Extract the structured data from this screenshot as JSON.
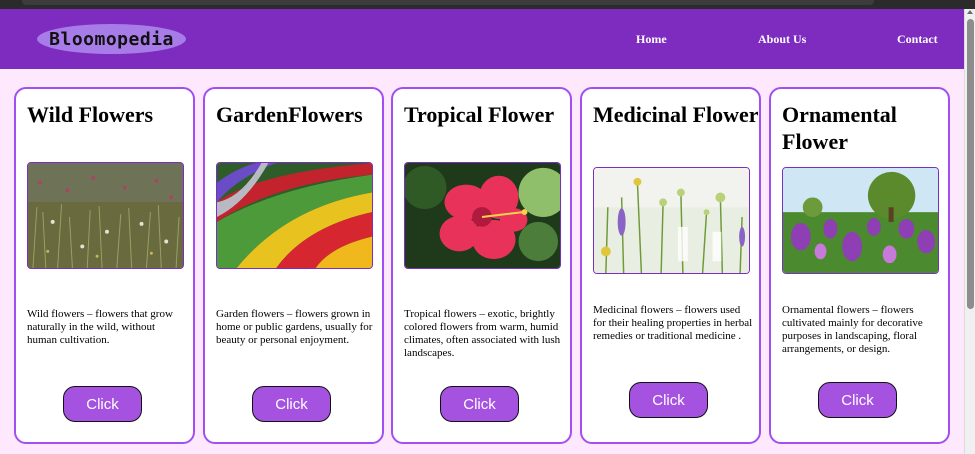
{
  "site": {
    "logo": "Bloomopedia",
    "nav": [
      "Home",
      "About Us",
      "Contact"
    ]
  },
  "cards": [
    {
      "title": "Wild Flowers",
      "image": "wildflower-meadow-image",
      "description": "Wild flowers – flowers that grow naturally in the wild, without human cultivation.",
      "button": "Click"
    },
    {
      "title": "GardenFlowers",
      "image": "tulip-garden-rows-image",
      "description": "Garden flowers – flowers grown in home or public gardens, usually for beauty or personal enjoyment.",
      "button": "Click"
    },
    {
      "title": "Tropical Flower",
      "image": "hibiscus-image",
      "description": "Tropical flowers – exotic, brightly colored flowers from warm, humid climates, often associated with lush landscapes.",
      "button": "Click"
    },
    {
      "title": "Medicinal Flower",
      "image": "medicinal-flowers-image",
      "description": "Medicinal flowers – flowers used for their healing properties in herbal remedies or traditional medicine .",
      "button": "Click"
    },
    {
      "title": "Ornamental Flower",
      "image": "purple-tulips-image",
      "description": "Ornamental flowers – flowers cultivated mainly for decorative purposes in landscaping, floral arrangements, or design.",
      "button": "Click"
    }
  ],
  "colors": {
    "navbar": "#7d2cbf",
    "page_background": "#fde8fd",
    "card_border": "#a14ff0",
    "button": "#a552e0",
    "logo_pill": "#a77ce8"
  }
}
